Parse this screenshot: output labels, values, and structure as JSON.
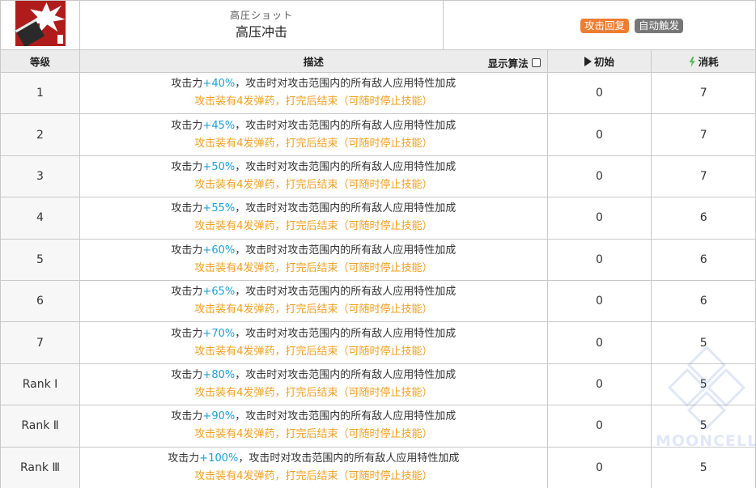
{
  "skill": {
    "name_jp": "高圧ショット",
    "name_cn": "高压冲击",
    "tags": [
      "攻击回复",
      "自动触发"
    ],
    "icon": "skill-burst-icon"
  },
  "columns": {
    "level": "等级",
    "desc": "描述",
    "formula_toggle": "显示算法",
    "init": "初始",
    "cost": "消耗"
  },
  "rows": [
    {
      "level": "1",
      "atk_prefix": "攻击力",
      "atk": "+40%",
      "atk_suffix": "，攻击时对攻击范围内的所有敌人应用特性加成",
      "note": "攻击装有4发弹药，打完后结束（可随时停止技能）",
      "init": "0",
      "cost": "7"
    },
    {
      "level": "2",
      "atk_prefix": "攻击力",
      "atk": "+45%",
      "atk_suffix": "，攻击时对攻击范围内的所有敌人应用特性加成",
      "note": "攻击装有4发弹药，打完后结束（可随时停止技能）",
      "init": "0",
      "cost": "7"
    },
    {
      "level": "3",
      "atk_prefix": "攻击力",
      "atk": "+50%",
      "atk_suffix": "，攻击时对攻击范围内的所有敌人应用特性加成",
      "note": "攻击装有4发弹药，打完后结束（可随时停止技能）",
      "init": "0",
      "cost": "7"
    },
    {
      "level": "4",
      "atk_prefix": "攻击力",
      "atk": "+55%",
      "atk_suffix": "，攻击时对攻击范围内的所有敌人应用特性加成",
      "note": "攻击装有4发弹药，打完后结束（可随时停止技能）",
      "init": "0",
      "cost": "6"
    },
    {
      "level": "5",
      "atk_prefix": "攻击力",
      "atk": "+60%",
      "atk_suffix": "，攻击时对攻击范围内的所有敌人应用特性加成",
      "note": "攻击装有4发弹药，打完后结束（可随时停止技能）",
      "init": "0",
      "cost": "6"
    },
    {
      "level": "6",
      "atk_prefix": "攻击力",
      "atk": "+65%",
      "atk_suffix": "，攻击时对攻击范围内的所有敌人应用特性加成",
      "note": "攻击装有4发弹药，打完后结束（可随时停止技能）",
      "init": "0",
      "cost": "6"
    },
    {
      "level": "7",
      "atk_prefix": "攻击力",
      "atk": "+70%",
      "atk_suffix": "，攻击时对攻击范围内的所有敌人应用特性加成",
      "note": "攻击装有4发弹药，打完后结束（可随时停止技能）",
      "init": "0",
      "cost": "5"
    },
    {
      "level": "Rank Ⅰ",
      "atk_prefix": "攻击力",
      "atk": "+80%",
      "atk_suffix": "，攻击时对攻击范围内的所有敌人应用特性加成",
      "note": "攻击装有4发弹药，打完后结束（可随时停止技能）",
      "init": "0",
      "cost": "5"
    },
    {
      "level": "Rank Ⅱ",
      "atk_prefix": "攻击力",
      "atk": "+90%",
      "atk_suffix": "，攻击时对攻击范围内的所有敌人应用特性加成",
      "note": "攻击装有4发弹药，打完后结束（可随时停止技能）",
      "init": "0",
      "cost": "5"
    },
    {
      "level": "Rank Ⅲ",
      "atk_prefix": "攻击力",
      "atk": "+100%",
      "atk_suffix": "，攻击时对攻击范围内的所有敌人应用特性加成",
      "note": "攻击装有4发弹药，打完后结束（可随时停止技能）",
      "init": "0",
      "cost": "5"
    }
  ],
  "watermark": "MOONCELL",
  "colors": {
    "accent_blue": "#1e9fd6",
    "note_orange": "#f0a020",
    "tag_orange": "#ef7d31",
    "tag_gray": "#777777",
    "bolt_green": "#5cb85c"
  }
}
